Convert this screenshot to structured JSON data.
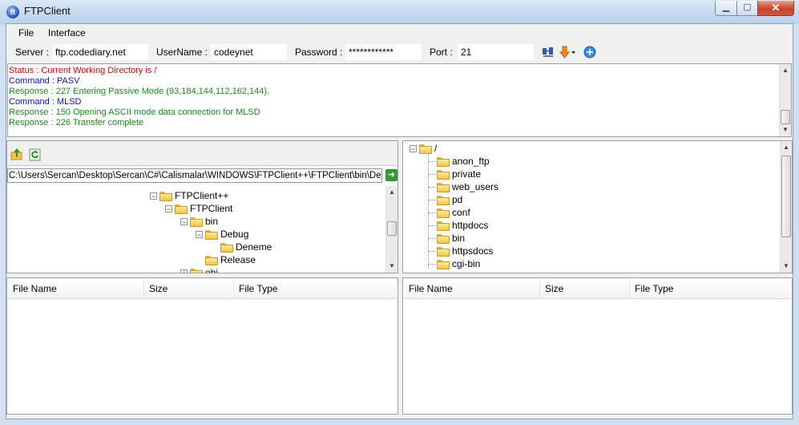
{
  "window": {
    "title": "FTPClient",
    "icon": "ftp-app-icon"
  },
  "menu": {
    "items": [
      "File",
      "Interface"
    ]
  },
  "connection": {
    "server_label": "Server :",
    "server_value": "ftp.codediary.net",
    "username_label": "UserName :",
    "username_value": "codeynet",
    "password_label": "Password :",
    "password_value": "************",
    "port_label": "Port :",
    "port_value": "21",
    "icons": [
      "connect-icon",
      "download-icon",
      "disconnect-icon"
    ]
  },
  "log": [
    {
      "text": "Status : Current Working Directory is /",
      "color": "#e00000"
    },
    {
      "text": "Command : PASV",
      "color": "#1010d0"
    },
    {
      "text": "Response : 227 Entering Passive Mode (93,184,144,112,162,144).",
      "color": "#1a8a1a"
    },
    {
      "text": "Command : MLSD",
      "color": "#1010d0"
    },
    {
      "text": "Response : 150 Opening ASCII mode data connection for MLSD",
      "color": "#1a8a1a"
    },
    {
      "text": "Response : 226 Transfer complete",
      "color": "#1a8a1a"
    }
  ],
  "local": {
    "path": "C:\\Users\\Sercan\\Desktop\\Sercan\\C#\\Calismalar\\WINDOWS\\FTPClient++\\FTPClient\\bin\\Debug",
    "tree": [
      {
        "label": "FTPClient++",
        "depth": 0,
        "expander": "−"
      },
      {
        "label": "FTPClient",
        "depth": 1,
        "expander": "−"
      },
      {
        "label": "bin",
        "depth": 2,
        "expander": "−"
      },
      {
        "label": "Debug",
        "depth": 3,
        "expander": "−"
      },
      {
        "label": "Deneme",
        "depth": 4,
        "expander": ""
      },
      {
        "label": "Release",
        "depth": 3,
        "expander": ""
      },
      {
        "label": "obj",
        "depth": 2,
        "expander": "+"
      }
    ]
  },
  "remote": {
    "root": "/",
    "folders": [
      "anon_ftp",
      "private",
      "web_users",
      "pd",
      "conf",
      "httpdocs",
      "bin",
      "httpsdocs",
      "cgi-bin"
    ]
  },
  "local_list": {
    "columns": [
      "File Name",
      "Size",
      "File Type"
    ]
  },
  "remote_list": {
    "columns": [
      "File Name",
      "Size",
      "File Type"
    ]
  }
}
